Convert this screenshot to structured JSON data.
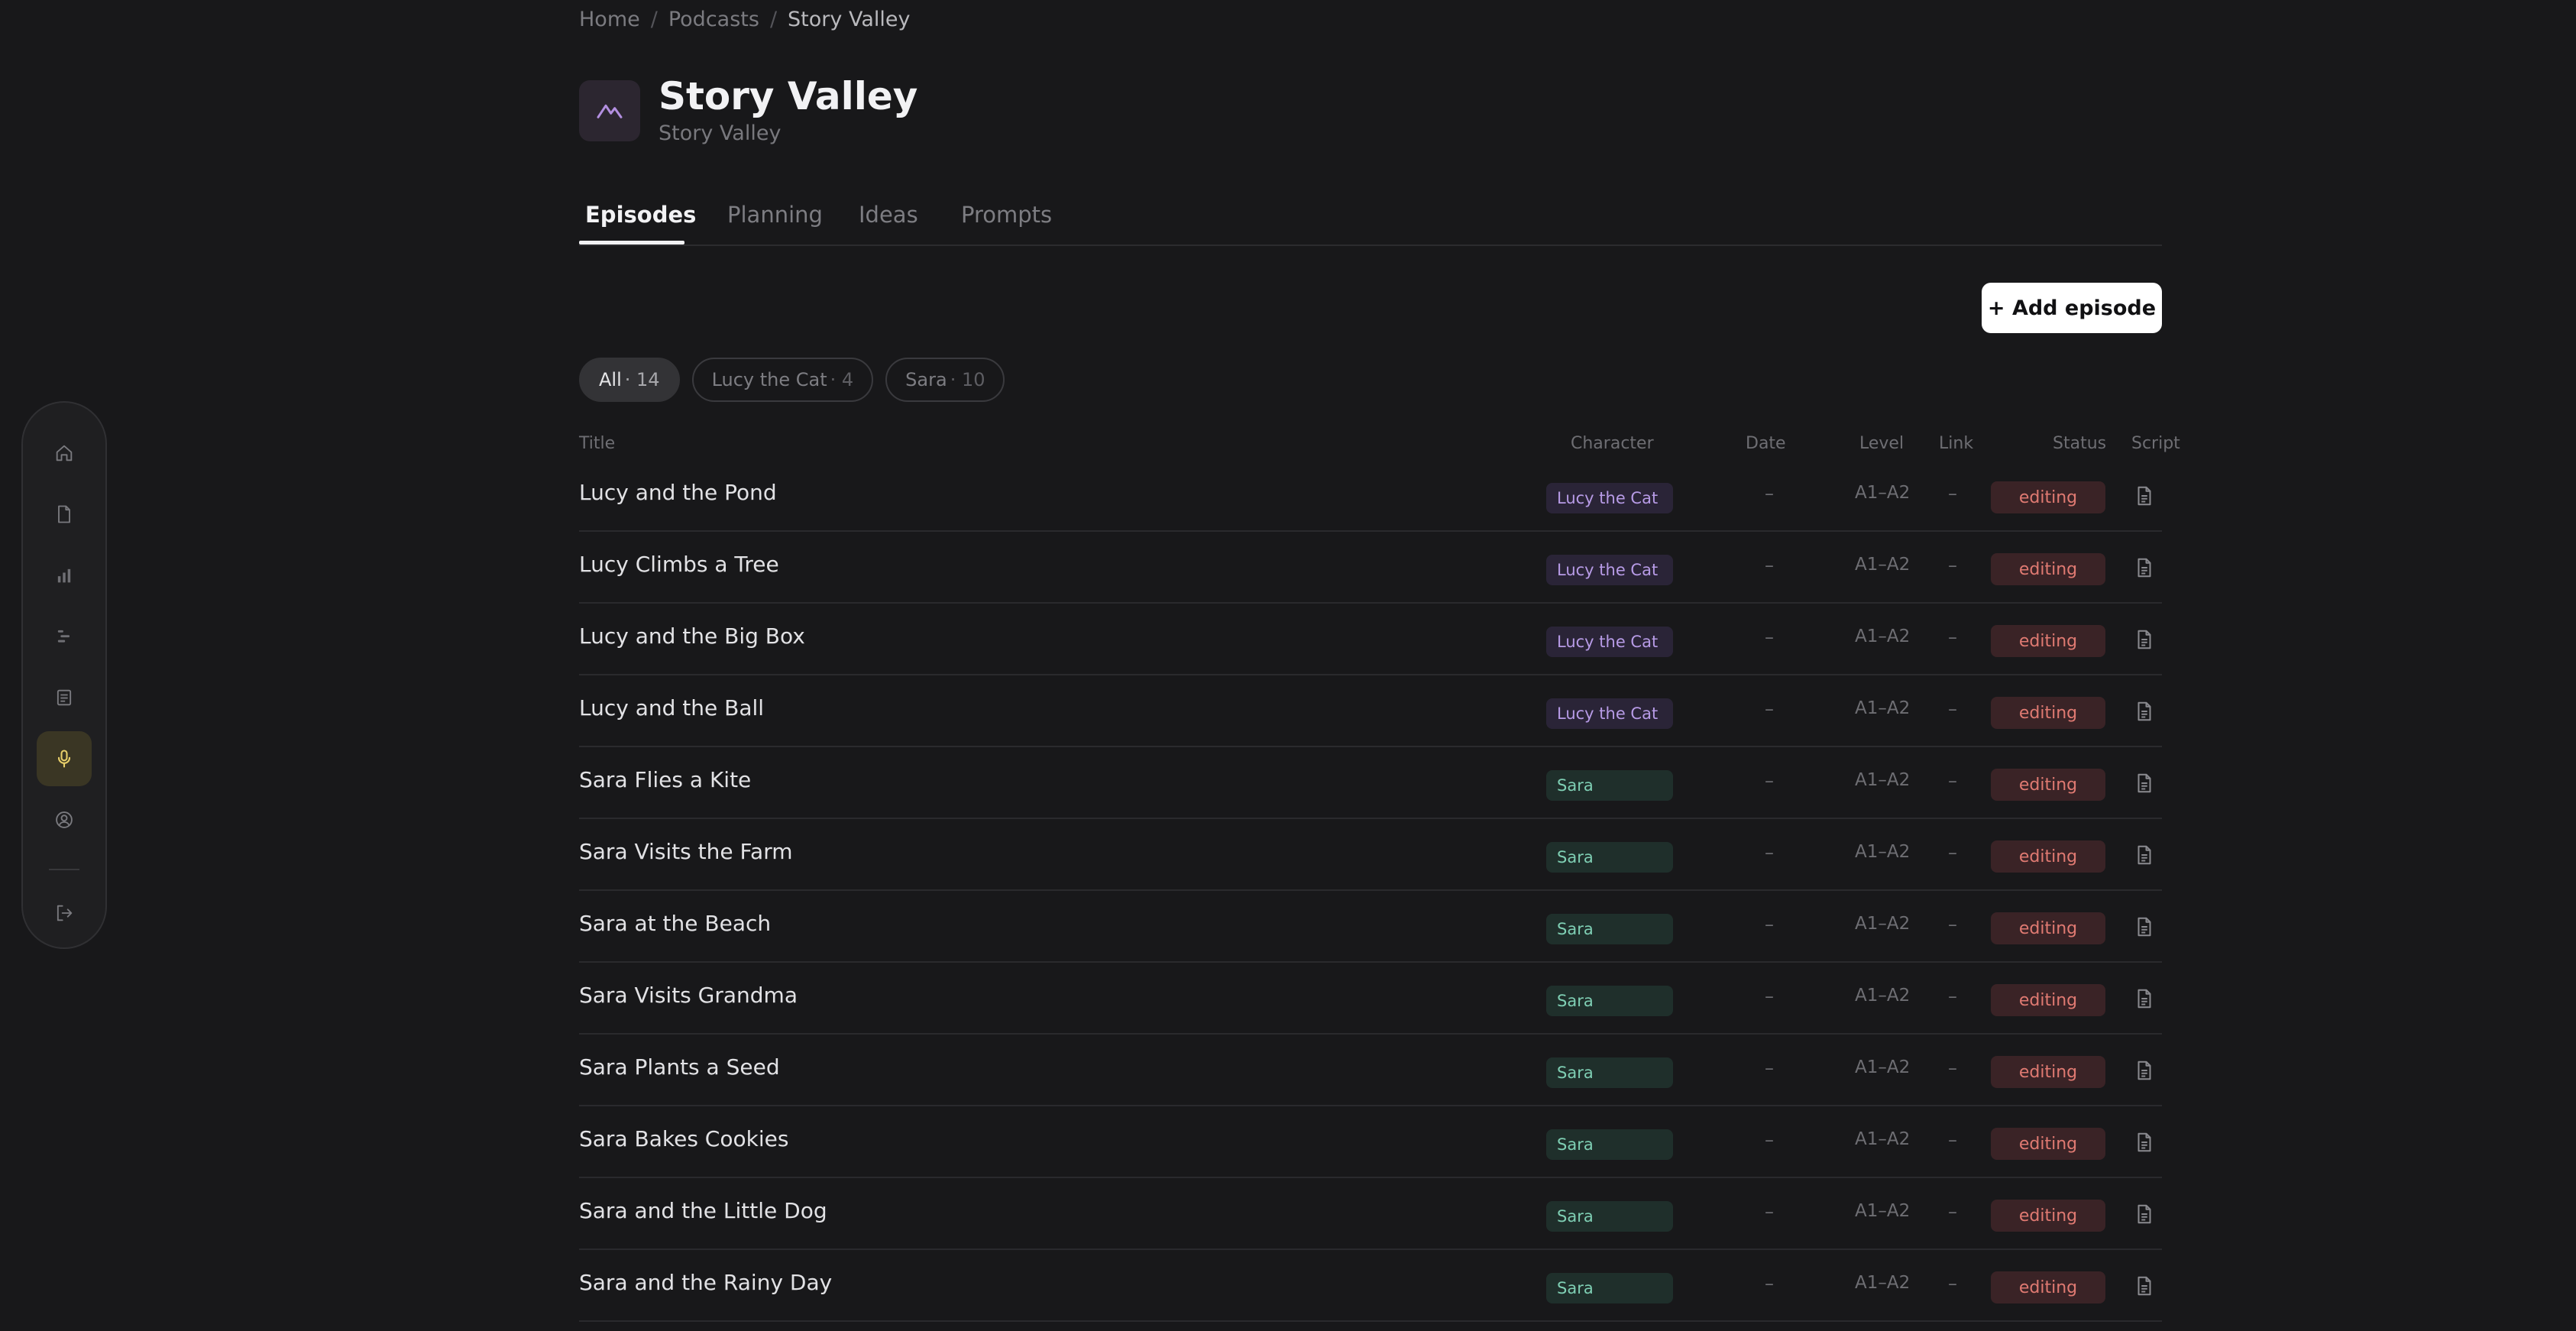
{
  "sidebar": {
    "items": [
      {
        "icon": "home-icon"
      },
      {
        "icon": "document-icon"
      },
      {
        "icon": "bar-chart-icon"
      },
      {
        "icon": "timeline-icon"
      },
      {
        "icon": "notes-icon"
      },
      {
        "icon": "microphone-icon",
        "active": true
      },
      {
        "icon": "user-circle-icon"
      }
    ],
    "logout_icon": "logout-icon"
  },
  "breadcrumb": {
    "home": "Home",
    "podcasts": "Podcasts",
    "current": "Story Valley"
  },
  "header": {
    "title": "Story Valley",
    "subtitle": "Story Valley",
    "logo_icon": "mountain-logo-icon"
  },
  "tabs": [
    "Episodes",
    "Planning",
    "Ideas",
    "Prompts"
  ],
  "add_button": "+ Add episode",
  "filters": [
    {
      "label": "All",
      "count": "· 14"
    },
    {
      "label": "Lucy the Cat",
      "count": "· 4"
    },
    {
      "label": "Sara",
      "count": "· 10"
    }
  ],
  "table": {
    "headers": {
      "title": "Title",
      "character": "Character",
      "date": "Date",
      "level": "Level",
      "link": "Link",
      "status": "Status",
      "script": "Script"
    },
    "rows": [
      {
        "title": "Lucy and the Pond",
        "character": "Lucy the Cat",
        "date": "–",
        "level": "A1–A2",
        "link": "–",
        "status": "editing"
      },
      {
        "title": "Lucy Climbs a Tree",
        "character": "Lucy the Cat",
        "date": "–",
        "level": "A1–A2",
        "link": "–",
        "status": "editing"
      },
      {
        "title": "Lucy and the Big Box",
        "character": "Lucy the Cat",
        "date": "–",
        "level": "A1–A2",
        "link": "–",
        "status": "editing"
      },
      {
        "title": "Lucy and the Ball",
        "character": "Lucy the Cat",
        "date": "–",
        "level": "A1–A2",
        "link": "–",
        "status": "editing"
      },
      {
        "title": "Sara Flies a Kite",
        "character": "Sara",
        "date": "–",
        "level": "A1–A2",
        "link": "–",
        "status": "editing"
      },
      {
        "title": "Sara Visits the Farm",
        "character": "Sara",
        "date": "–",
        "level": "A1–A2",
        "link": "–",
        "status": "editing"
      },
      {
        "title": "Sara at the Beach",
        "character": "Sara",
        "date": "–",
        "level": "A1–A2",
        "link": "–",
        "status": "editing"
      },
      {
        "title": "Sara Visits Grandma",
        "character": "Sara",
        "date": "–",
        "level": "A1–A2",
        "link": "–",
        "status": "editing"
      },
      {
        "title": "Sara Plants a Seed",
        "character": "Sara",
        "date": "–",
        "level": "A1–A2",
        "link": "–",
        "status": "editing"
      },
      {
        "title": "Sara Bakes Cookies",
        "character": "Sara",
        "date": "–",
        "level": "A1–A2",
        "link": "–",
        "status": "editing"
      },
      {
        "title": "Sara and the Little Dog",
        "character": "Sara",
        "date": "–",
        "level": "A1–A2",
        "link": "–",
        "status": "editing"
      },
      {
        "title": "Sara and the Rainy Day",
        "character": "Sara",
        "date": "–",
        "level": "A1–A2",
        "link": "–",
        "status": "editing"
      }
    ]
  },
  "colors": {
    "background": "#18181a",
    "accent_active": "#e8cf6a",
    "cat_badge": "#b79be6",
    "sara_badge": "#7fcfb4",
    "status_editing": "#e07a72"
  }
}
